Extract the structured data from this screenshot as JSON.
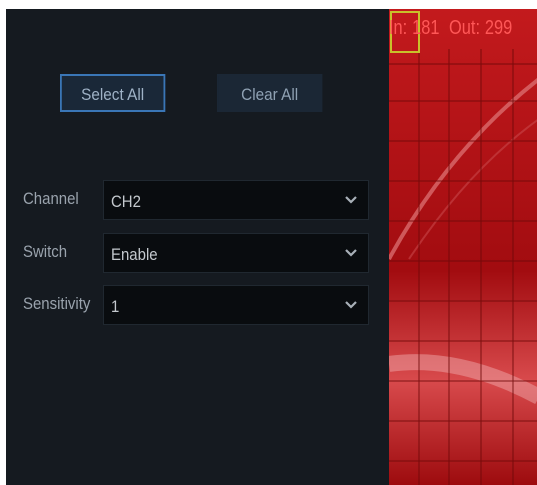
{
  "buttons": {
    "select_all": "Select All",
    "clear_all": "Clear All"
  },
  "settings": [
    {
      "label": "Channel",
      "value": "CH2"
    },
    {
      "label": "Switch",
      "value": "Enable"
    },
    {
      "label": "Sensitivity",
      "value": "1"
    }
  ],
  "video": {
    "in_label": "In:",
    "in_count": "181",
    "out_label": "Out:",
    "out_count": "299"
  },
  "colors": {
    "panel": "#151a20",
    "accent": "#3a76b6",
    "video_red": "#a50d10",
    "detection_box": "#c9c12a"
  }
}
